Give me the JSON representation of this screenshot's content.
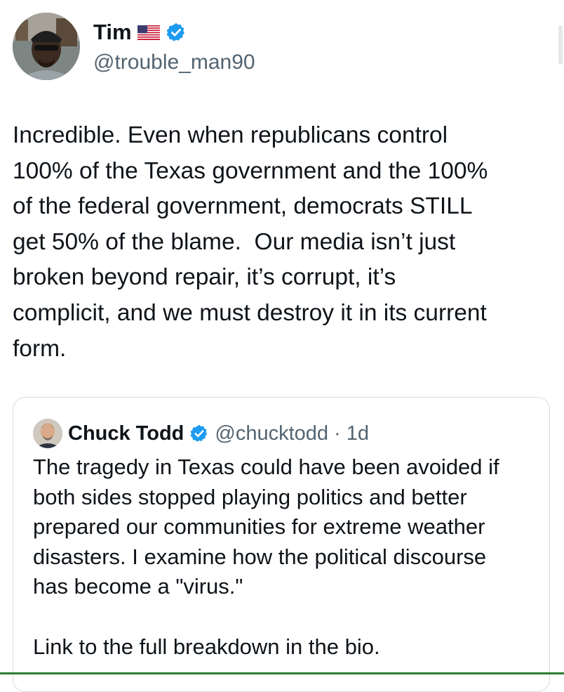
{
  "author": {
    "display_name": "Tim",
    "handle": "@trouble_man90",
    "flag_icon": "us-flag-icon",
    "verified_icon": "verified-badge-icon"
  },
  "tweet": {
    "text": "Incredible. Even when republicans control\n100% of the Texas government and the 100%\nof the federal government, democrats STILL\nget 50% of the blame.  Our media isn’t just\nbroken beyond repair, it’s corrupt, it’s\ncomplicit, and we must destroy it in its current\nform."
  },
  "quoted_tweet": {
    "display_name": "Chuck Todd",
    "handle": "@chucktodd",
    "separator": "·",
    "time": "1d",
    "text": "The tragedy in Texas could have been avoided if\nboth sides stopped playing politics and better\nprepared our communities for extreme weather\ndisasters. I examine how the political discourse\nhas become a \"virus.\"\n\nLink to the full breakdown in the bio."
  },
  "colors": {
    "text": "#0f1419",
    "secondary_text": "#536471",
    "verified_blue": "#1d9bf0",
    "border": "#d7dbdf"
  }
}
